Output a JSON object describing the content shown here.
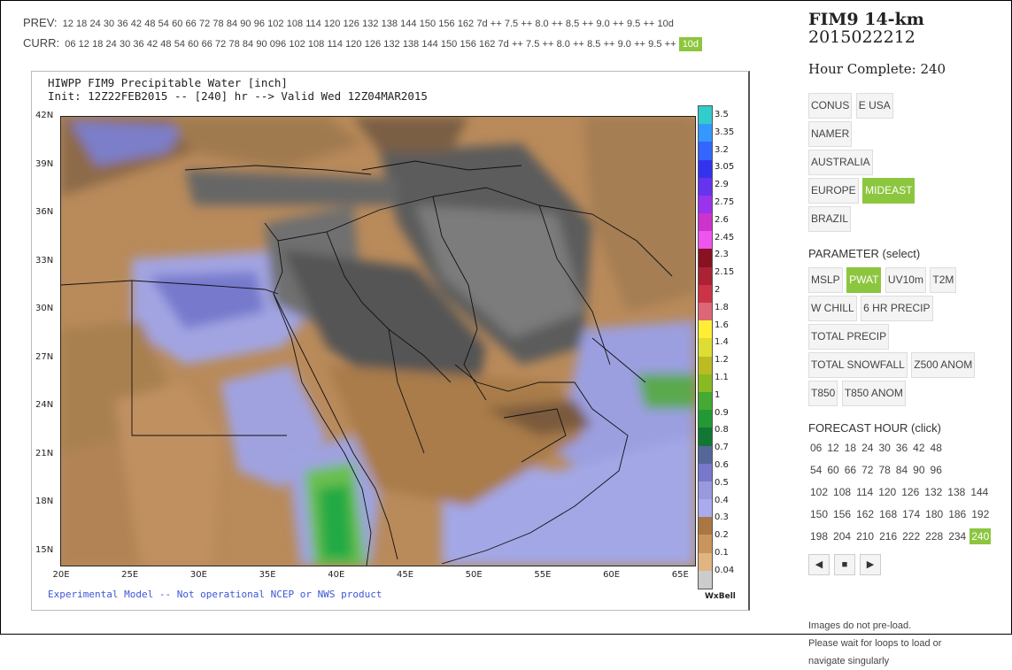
{
  "prev": {
    "label": "PREV:",
    "items": [
      "12",
      "18",
      "24",
      "30",
      "36",
      "42",
      "48",
      "54",
      "60",
      "66",
      "72",
      "78",
      "84",
      "90",
      "96",
      "102",
      "108",
      "114",
      "120",
      "126",
      "132",
      "138",
      "144",
      "150",
      "156",
      "162",
      "7d",
      "++",
      "7.5",
      "++",
      "8.0",
      "++",
      "8.5",
      "++",
      "9.0",
      "++",
      "9.5",
      "++",
      "10d"
    ]
  },
  "curr": {
    "label": "CURR:",
    "items": [
      "06",
      "12",
      "18",
      "24",
      "30",
      "36",
      "42",
      "48",
      "54",
      "60",
      "66",
      "72",
      "78",
      "84",
      "90",
      "096",
      "102",
      "108",
      "114",
      "120",
      "126",
      "132",
      "138",
      "144",
      "150",
      "156",
      "162",
      "7d",
      "++",
      "7.5",
      "++",
      "8.0",
      "++",
      "8.5",
      "++",
      "9.0",
      "++",
      "9.5",
      "++",
      "10d"
    ],
    "selected": "10d"
  },
  "map": {
    "title_line1": "HIWPP FIM9 Precipitable Water [inch]",
    "title_line2": "Init: 12Z22FEB2015 -- [240] hr --> Valid Wed 12Z04MAR2015",
    "y_ticks": [
      "42N",
      "39N",
      "36N",
      "33N",
      "30N",
      "27N",
      "24N",
      "21N",
      "18N",
      "15N"
    ],
    "x_ticks": [
      "20E",
      "25E",
      "30E",
      "35E",
      "40E",
      "45E",
      "50E",
      "55E",
      "60E",
      "65E"
    ],
    "footer": "Experimental Model -- Not operational NCEP or NWS product",
    "credit": "WxBell",
    "colorbar_labels": [
      "3.5",
      "3.35",
      "3.2",
      "3.05",
      "2.9",
      "2.75",
      "2.6",
      "2.45",
      "2.3",
      "2.15",
      "2",
      "1.8",
      "1.6",
      "1.4",
      "1.2",
      "1.1",
      "1",
      "0.9",
      "0.8",
      "0.7",
      "0.6",
      "0.5",
      "0.4",
      "0.3",
      "0.2",
      "0.1",
      "0.04"
    ],
    "colorbar_colors": [
      "#33cccc",
      "#3399ff",
      "#3366ff",
      "#3333ee",
      "#6633ee",
      "#9933ee",
      "#cc33cc",
      "#ee55ee",
      "#881122",
      "#aa2233",
      "#cc3344",
      "#dd6677",
      "#ffee33",
      "#dddd33",
      "#bbbb22",
      "#88bb22",
      "#44aa33",
      "#229933",
      "#117733",
      "#556699",
      "#7777cc",
      "#9999dd",
      "#aaaaee",
      "#aa7744",
      "#c8955c",
      "#e0b57f"
    ]
  },
  "side": {
    "title": "FIM9 14-km",
    "run": "2015022212",
    "hour_complete": "Hour Complete: 240",
    "regions": [
      {
        "label": "CONUS",
        "sel": false
      },
      {
        "label": "E USA",
        "sel": false
      },
      {
        "label": "NAMER",
        "sel": false
      },
      {
        "label": "AUSTRALIA",
        "sel": false
      },
      {
        "label": "EUROPE",
        "sel": false
      },
      {
        "label": "MIDEAST",
        "sel": true
      },
      {
        "label": "BRAZIL",
        "sel": false
      }
    ],
    "parameter_heading": "PARAMETER (select)",
    "parameters": [
      {
        "label": "MSLP",
        "sel": false
      },
      {
        "label": "PWAT",
        "sel": true
      },
      {
        "label": "UV10m",
        "sel": false
      },
      {
        "label": "T2M",
        "sel": false
      },
      {
        "label": "W CHILL",
        "sel": false
      },
      {
        "label": "6 HR PRECIP",
        "sel": false
      },
      {
        "label": "TOTAL PRECIP",
        "sel": false
      },
      {
        "label": "TOTAL SNOWFALL",
        "sel": false
      },
      {
        "label": "Z500 ANOM",
        "sel": false
      },
      {
        "label": "T850",
        "sel": false
      },
      {
        "label": "T850 ANOM",
        "sel": false
      }
    ],
    "forecast_heading": "FORECAST HOUR (click)",
    "hours": [
      [
        "06",
        "12",
        "18",
        "24",
        "30",
        "36",
        "42",
        "48"
      ],
      [
        "54",
        "60",
        "66",
        "72",
        "78",
        "84",
        "90",
        "96"
      ],
      [
        "102",
        "108",
        "114",
        "120",
        "126",
        "132",
        "138",
        "144"
      ],
      [
        "150",
        "156",
        "162",
        "168",
        "174",
        "180",
        "186",
        "192"
      ],
      [
        "198",
        "204",
        "210",
        "216",
        "222",
        "228",
        "234",
        "240"
      ]
    ],
    "selected_hour": "240",
    "controls": [
      "◀",
      "■",
      "▶"
    ],
    "note_lines": [
      "Images do not pre-load.",
      "Please wait for loops to load or",
      "navigate singularly"
    ]
  }
}
